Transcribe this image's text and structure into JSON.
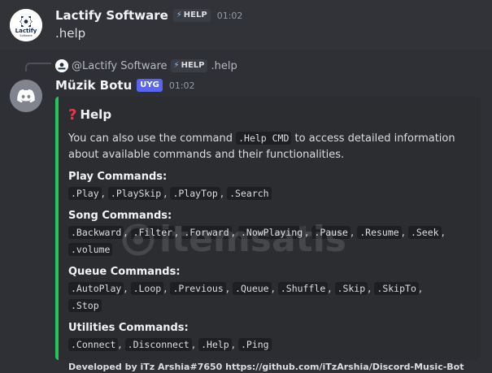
{
  "message1": {
    "username": "Lactify Software",
    "badge": "HELP",
    "timestamp": "01:02",
    "content": ".help",
    "avatar_logo_text": "Lactify"
  },
  "reply": {
    "mention": "@Lactify Software",
    "badge": "HELP",
    "text": ".help"
  },
  "message2": {
    "username": "Müzik Botu",
    "badge": "UYG",
    "timestamp": "01:02",
    "embed": {
      "title": "Help",
      "description_pre": "You can also use the command ",
      "description_code": ".Help CMD",
      "description_post": " to access detailed information about available commands and their functionalities.",
      "fields": [
        {
          "name": "Play Commands:",
          "values": [
            ".Play",
            ".PlaySkip",
            ".PlayTop",
            ".Search"
          ]
        },
        {
          "name": "Song Commands:",
          "values": [
            ".Backward",
            ".Filter",
            ".Forward",
            ".NowPlaying",
            ".Pause",
            ".Resume",
            ".Seek",
            ".volume"
          ]
        },
        {
          "name": "Queue Commands:",
          "values": [
            ".AutoPlay",
            ".Loop",
            ".Previous",
            ".Queue",
            ".Shuffle",
            ".Skip",
            ".SkipTo",
            ".Stop"
          ]
        },
        {
          "name": "Utilities Commands:",
          "values": [
            ".Connect",
            ".Disconnect",
            ".Help",
            ".Ping"
          ]
        }
      ],
      "footer": "Developed by iTz Arshia#7650 https://github.com/iTzArshia/Discord-Music-Bot",
      "accent_color": "#23c55e"
    }
  },
  "watermark": {
    "text": "itemsatis"
  },
  "colors": {
    "background": "#313338",
    "hover_background": "#2e3035",
    "embed_background": "#2b2d31",
    "bot_badge": "#5865f2"
  }
}
